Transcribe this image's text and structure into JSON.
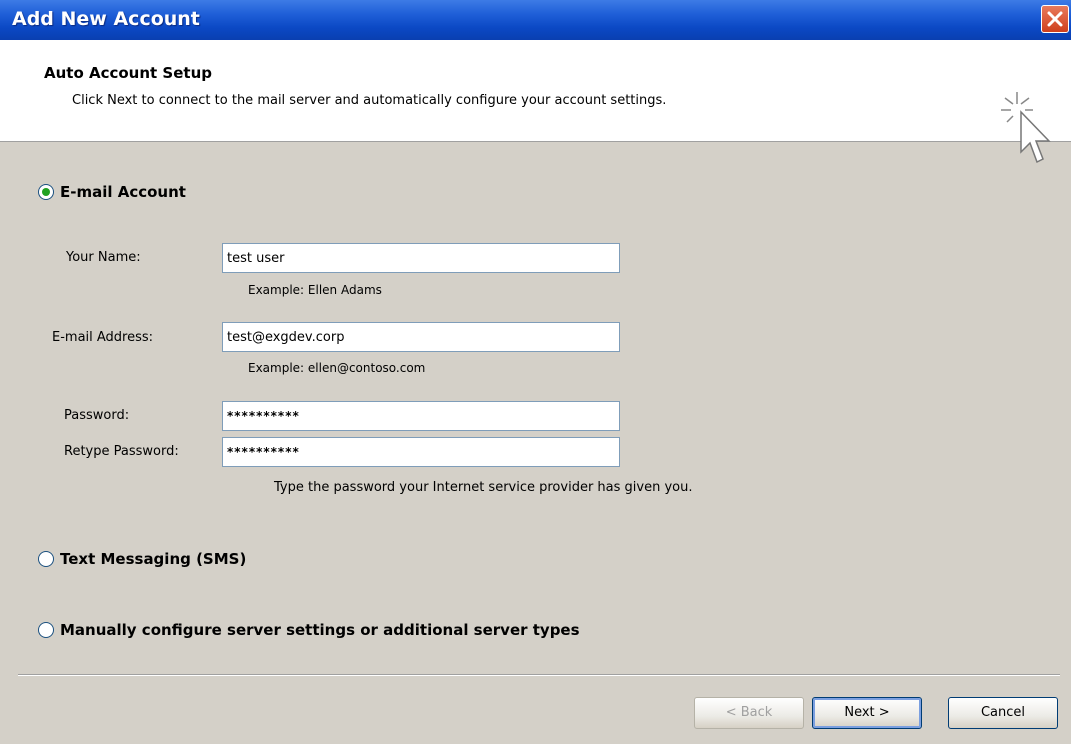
{
  "window": {
    "title": "Add New Account"
  },
  "header": {
    "title": "Auto Account Setup",
    "subtitle": "Click Next to connect to the mail server and automatically configure your account settings."
  },
  "options": {
    "email_account": "E-mail Account",
    "text_messaging": "Text Messaging (SMS)",
    "manual": "Manually configure server settings or additional server types"
  },
  "form": {
    "name_label": "Your Name:",
    "name_value": "test user",
    "name_example": "Example: Ellen Adams",
    "email_label": "E-mail Address:",
    "email_value": "test@exgdev.corp",
    "email_example": "Example: ellen@contoso.com",
    "password_label": "Password:",
    "password_value": "**********",
    "retype_label": "Retype Password:",
    "retype_value": "**********",
    "password_hint": "Type the password your Internet service provider has given you."
  },
  "buttons": {
    "back": "< Back",
    "next": "Next >",
    "cancel": "Cancel"
  }
}
